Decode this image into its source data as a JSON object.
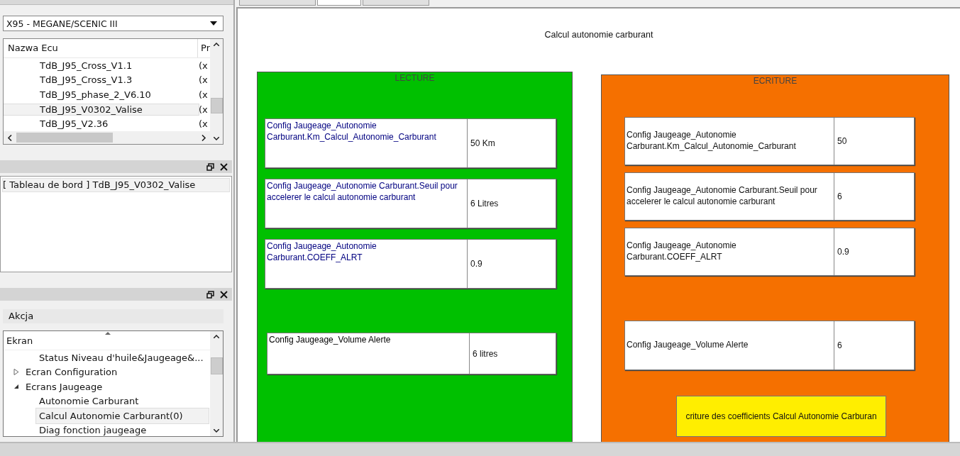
{
  "main_tabs": [
    {
      "selected": false
    },
    {
      "selected": true
    },
    {
      "selected": false
    }
  ],
  "vehicle_select": {
    "value": "X95 - MEGANE/SCENIC III"
  },
  "ecu_table": {
    "columns": [
      "Nazwa Ecu",
      "Pr"
    ],
    "rows": [
      {
        "name": "TdB_J95_Cross_V1.1",
        "column_2": "(x",
        "selected": false
      },
      {
        "name": "TdB_J95_Cross_V1.3",
        "column_2": "(x",
        "selected": false
      },
      {
        "name": "TdB_J95_phase_2_V6.10",
        "column_2": "(x",
        "selected": false
      },
      {
        "name": "TdB_J95_V0302_Valise",
        "column_2": "(x",
        "selected": true
      },
      {
        "name": "TdB_J95_V2.36",
        "column_2": "(x",
        "selected": false
      }
    ]
  },
  "ecu_panel": {
    "items": [
      {
        "label": "[ Tableau de bord ] TdB_J95_V0302_Valise",
        "selected": true
      }
    ]
  },
  "action_panel": {
    "header": "Akcja",
    "tree_header": "Ekran",
    "tree": [
      {
        "label": "Status Niveau d'huile&Jaugeage&...",
        "selected": false
      },
      {
        "label": "Ecran Configuration",
        "selected": false,
        "expanded": false
      },
      {
        "label": "Ecrans Jaugeage",
        "selected": false,
        "expanded": true,
        "children": [
          {
            "label": "Autonomie Carburant",
            "selected": false
          },
          {
            "label": "Calcul Autonomie Carburant(0)",
            "selected": true
          },
          {
            "label": "Diag fonction jaugeage",
            "selected": false
          }
        ]
      }
    ]
  },
  "screen": {
    "title": "Calcul autonomie carburant",
    "panels": [
      {
        "kind": "read",
        "title": "LECTURE",
        "rows": [
          {
            "label": "Config Jaugeage_Autonomie Carburant.Km_Calcul_Autonomie_Carburant",
            "value": "50 Km"
          },
          {
            "label": "Config Jaugeage_Autonomie Carburant.Seuil pour accelerer le calcul autonomie carburant",
            "value": "6 Litres"
          },
          {
            "label": "Config Jaugeage_Autonomie Carburant.COEFF_ALRT",
            "value": "0.9"
          },
          {
            "label": "Config Jaugeage_Volume Alerte",
            "value": "6 litres"
          }
        ]
      },
      {
        "kind": "write",
        "title": "ECRITURE",
        "rows": [
          {
            "label": "Config Jaugeage_Autonomie Carburant.Km_Calcul_Autonomie_Carburant",
            "value": "50"
          },
          {
            "label": "Config Jaugeage_Autonomie Carburant.Seuil pour accelerer le calcul autonomie carburant",
            "value": "6"
          },
          {
            "label": "Config Jaugeage_Autonomie Carburant.COEFF_ALRT",
            "value": "0.9"
          },
          {
            "label": "Config Jaugeage_Volume Alerte",
            "value": "6"
          }
        ],
        "button": "criture des coefficients Calcul Autonomie Carburan"
      }
    ]
  }
}
